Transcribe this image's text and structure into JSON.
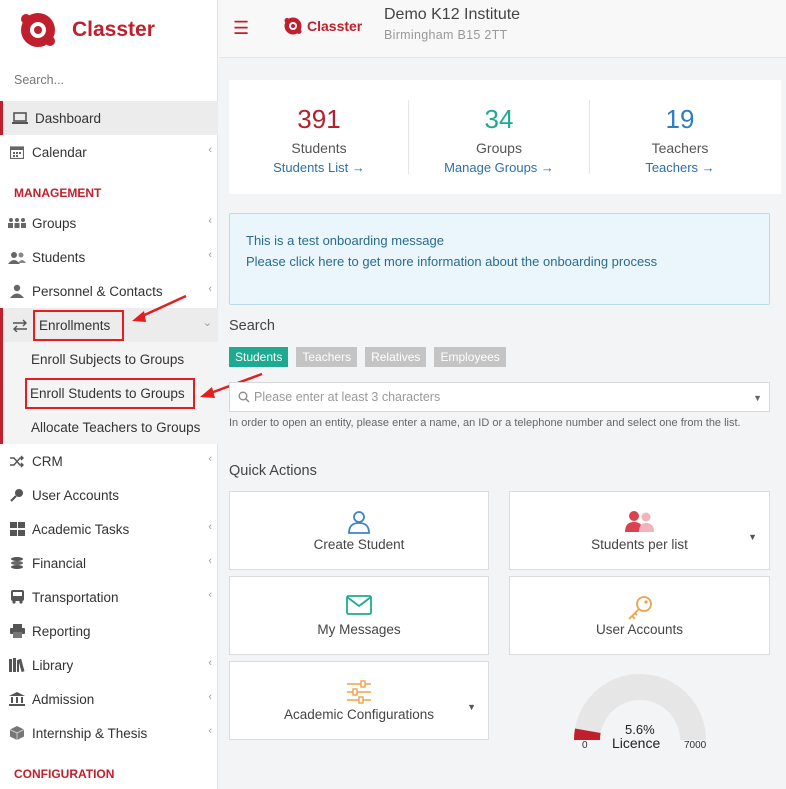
{
  "sidebar": {
    "logo_text": "Classter",
    "search_placeholder": "Search...",
    "items": [
      {
        "label": "Dashboard"
      },
      {
        "label": "Calendar"
      }
    ],
    "management_header": "MANAGEMENT",
    "management": [
      {
        "label": "Groups"
      },
      {
        "label": "Students"
      },
      {
        "label": "Personnel & Contacts"
      },
      {
        "label": "Enrollments"
      }
    ],
    "enrollment_sub": [
      {
        "label": "Enroll Subjects to Groups"
      },
      {
        "label": "Enroll Students to Groups"
      },
      {
        "label": "Allocate Teachers to Groups"
      }
    ],
    "more": [
      {
        "label": "CRM"
      },
      {
        "label": "User Accounts"
      },
      {
        "label": "Academic Tasks"
      },
      {
        "label": "Financial"
      },
      {
        "label": "Transportation"
      },
      {
        "label": "Reporting"
      },
      {
        "label": "Library"
      },
      {
        "label": "Admission"
      },
      {
        "label": "Internship & Thesis"
      }
    ],
    "configuration_header": "CONFIGURATION"
  },
  "header": {
    "logo_text": "Classter",
    "institute_name": "Demo K12 Institute",
    "institute_address": "Birmingham B15 2TT"
  },
  "stats": [
    {
      "value": "391",
      "label": "Students",
      "link": "Students List →",
      "color": "#b3202f"
    },
    {
      "value": "34",
      "label": "Groups",
      "link": "Manage Groups →",
      "color": "#1eaa91"
    },
    {
      "value": "19",
      "label": "Teachers",
      "link": "Teachers →",
      "color": "#2d7fc1"
    }
  ],
  "onboarding": {
    "line1": "This is a test onboarding message",
    "line2": "Please click here to get more information about the onboarding process"
  },
  "search": {
    "title": "Search",
    "tabs": [
      "Students",
      "Teachers",
      "Relatives",
      "Employees"
    ],
    "placeholder": "Please enter at least 3 characters",
    "hint": "In order to open an entity, please enter a name, an ID or a telephone number and select one from the list."
  },
  "quick_actions": {
    "title": "Quick Actions",
    "create_student": "Create Student",
    "students_per_list": "Students per list",
    "my_messages": "My Messages",
    "user_accounts": "User Accounts",
    "academic_configurations": "Academic Configurations"
  },
  "licence": {
    "percent": "5.6%",
    "label": "Licence",
    "min": "0",
    "max": "7000",
    "used_fraction": 0.056
  }
}
